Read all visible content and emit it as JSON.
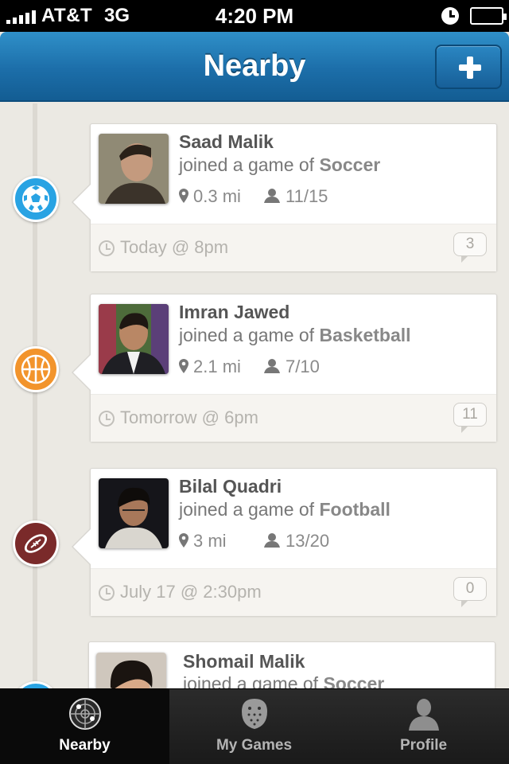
{
  "status_bar": {
    "carrier": "AT&T",
    "network": "3G",
    "time": "4:20 PM",
    "signal_bars": 5,
    "icons": [
      "signal-icon",
      "alarm-icon",
      "battery-icon"
    ]
  },
  "nav": {
    "title": "Nearby",
    "add_button_icon": "plus-icon"
  },
  "feed": [
    {
      "name": "Saad Malik",
      "activity_prefix": "joined a game of",
      "sport": "Soccer",
      "sport_icon": "soccer-ball-icon",
      "sport_color": "#29a3e3",
      "distance": "0.3 mi",
      "players": "11/15",
      "time": "Today @ 8pm",
      "comments": "3"
    },
    {
      "name": "Imran Jawed",
      "activity_prefix": "joined a game of",
      "sport": "Basketball",
      "sport_icon": "basketball-icon",
      "sport_color": "#f2942c",
      "distance": "2.1 mi",
      "players": "7/10",
      "time": "Tomorrow @ 6pm",
      "comments": "11"
    },
    {
      "name": "Bilal Quadri",
      "activity_prefix": "joined a game of",
      "sport": "Football",
      "sport_icon": "football-icon",
      "sport_color": "#7a2a2a",
      "distance": "3 mi",
      "players": "13/20",
      "time": "July 17 @ 2:30pm",
      "comments": "0"
    },
    {
      "name": "Shomail Malik",
      "activity_prefix": "joined a game of",
      "sport": "Soccer",
      "sport_icon": "soccer-ball-icon",
      "sport_color": "#29a3e3"
    }
  ],
  "tabs": [
    {
      "label": "Nearby",
      "icon": "radar-icon",
      "active": true
    },
    {
      "label": "My Games",
      "icon": "hockey-mask-icon",
      "active": false
    },
    {
      "label": "Profile",
      "icon": "person-icon",
      "active": false
    }
  ],
  "colors": {
    "nav_blue": "#1c6ea9",
    "background": "#ebe9e3",
    "tab_bar": "#1a1a1a"
  }
}
